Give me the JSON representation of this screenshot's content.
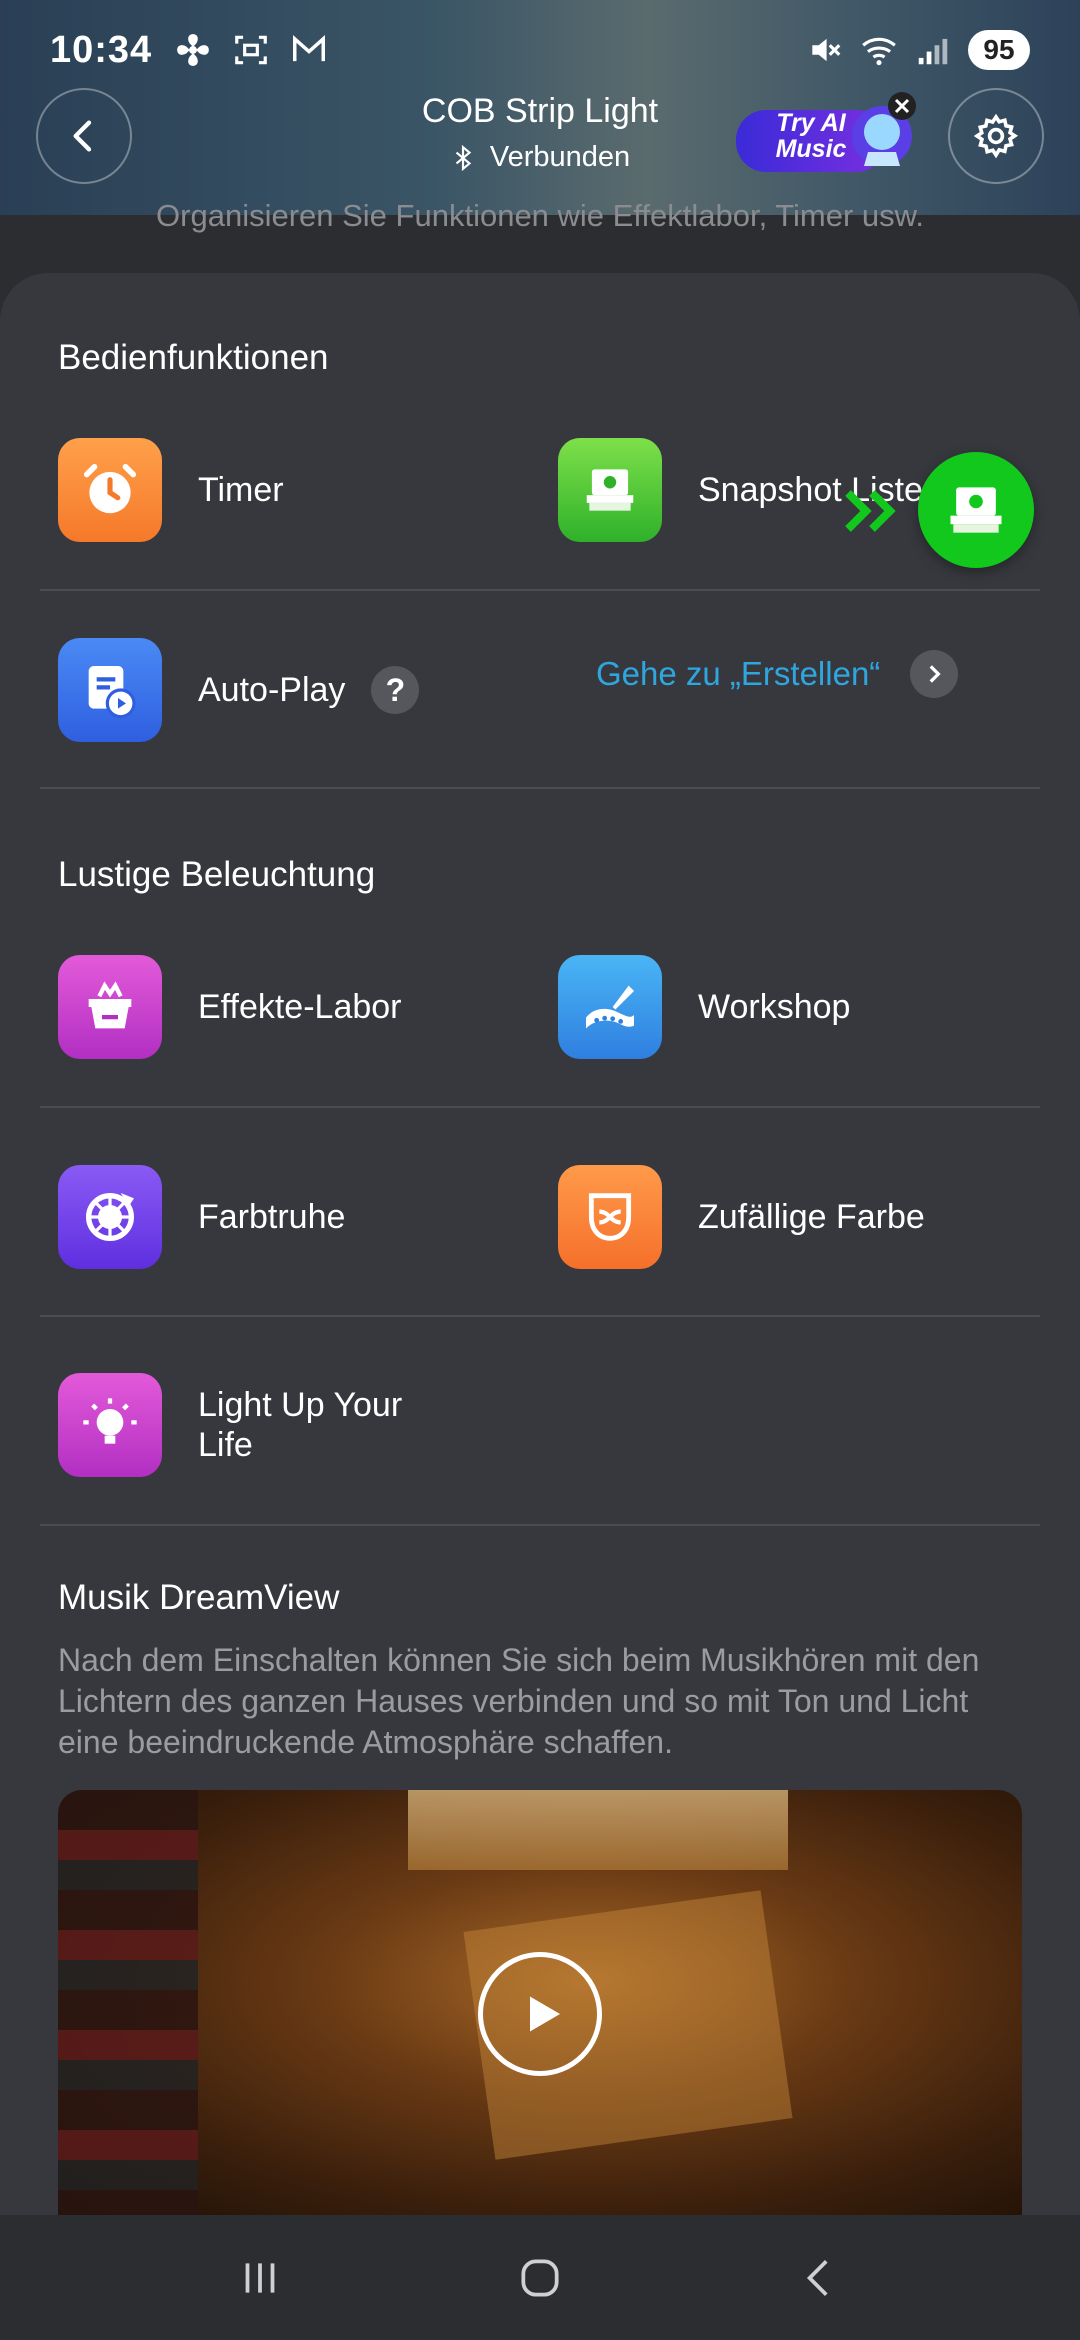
{
  "status_bar": {
    "time": "10:34",
    "battery": "95"
  },
  "header": {
    "title": "COB Strip Light",
    "connection_status": "Verbunden",
    "ai_badge_line1": "Try AI",
    "ai_badge_line2": "Music",
    "peek_text": "Organisieren Sie Funktionen wie Effektlabor, Timer usw."
  },
  "sections": {
    "controls": {
      "title": "Bedienfunktionen",
      "timer": "Timer",
      "snapshot": "Snapshot Liste",
      "autoplay": "Auto-Play",
      "autoplay_help": "?",
      "goto_create": "Gehe zu „Erstellen“"
    },
    "fun_lighting": {
      "title": "Lustige Beleuchtung",
      "effects_lab": "Effekte-Labor",
      "workshop": "Workshop",
      "color_chest": "Farbtruhe",
      "random_color": "Zufällige Farbe",
      "light_up_line1": "Light Up Your",
      "light_up_line2": "Life"
    },
    "dreamview": {
      "title": "Musik DreamView",
      "description": "Nach dem Einschalten können Sie sich beim Musikhören mit den Lichtern des ganzen Hauses verbinden und so mit Ton und Licht eine beeindruckende Atmosphäre schaffen."
    }
  },
  "colors": {
    "accent_link": "#2fa6de",
    "floating_button": "#12c81d",
    "card_background": "#36383e"
  },
  "icons": [
    "back-icon",
    "bluetooth-icon",
    "gear-icon",
    "clock-icon",
    "snapshot-icon",
    "autoplay-icon",
    "basket-icon",
    "paint-strip-icon",
    "color-wheel-icon",
    "mask-icon",
    "bulb-icon",
    "play-icon"
  ]
}
